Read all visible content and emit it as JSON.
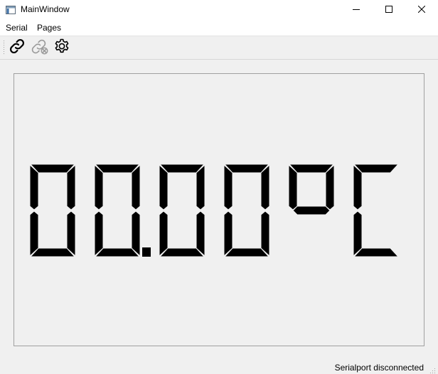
{
  "window": {
    "title": "MainWindow",
    "icon": "app-window-icon",
    "controls": [
      "minimize-icon",
      "maximize-icon",
      "close-icon"
    ]
  },
  "menu": {
    "items": [
      {
        "label": "Serial"
      },
      {
        "label": "Pages"
      }
    ]
  },
  "toolbar": {
    "buttons": [
      {
        "icon": "link-icon",
        "state": "enabled"
      },
      {
        "icon": "link-broken-icon",
        "state": "disabled"
      },
      {
        "icon": "gear-icon",
        "state": "enabled"
      }
    ]
  },
  "display": {
    "value": "00.00",
    "unit": "°C",
    "readout": "00.00°C",
    "segment_color": "#000000"
  },
  "status": {
    "text": "Serialport disconnected"
  }
}
